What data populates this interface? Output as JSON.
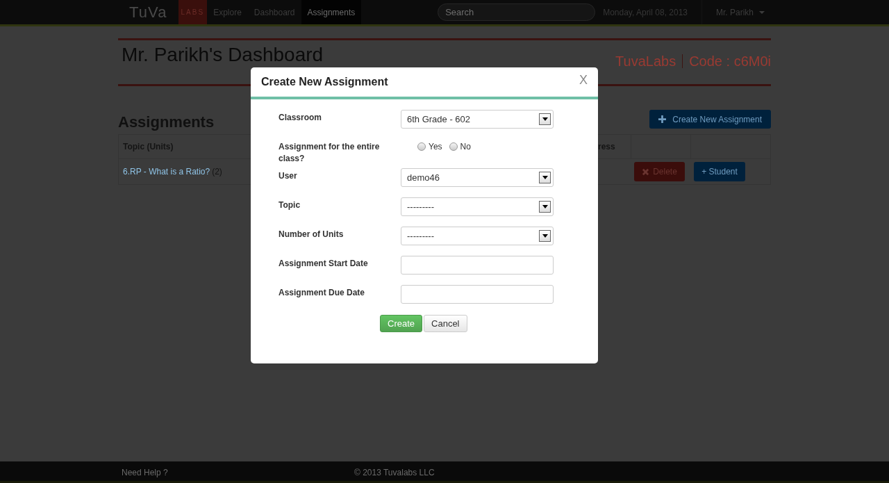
{
  "navbar": {
    "logo": "TuVa",
    "logo_badge": "LABS",
    "items": [
      {
        "label": "Explore",
        "selected": false
      },
      {
        "label": "Dashboard",
        "selected": false
      },
      {
        "label": "Assignments",
        "selected": true
      }
    ],
    "search": {
      "placeholder": "Search"
    },
    "date": "Monday, April 08, 2013",
    "user": "Mr. Parikh"
  },
  "page": {
    "title": "Mr. Parikh's Dashboard",
    "brand": "TuvaLabs",
    "code_label": "Code : c6M0i"
  },
  "assignments": {
    "heading": "Assignments",
    "create_button": "Create New Assignment",
    "columns": [
      "Topic (Units)",
      "ress"
    ],
    "rows": [
      {
        "topic": "6.RP - What is a Ratio?",
        "units": "(2)",
        "delete": "Delete",
        "student": "+ Student"
      }
    ]
  },
  "modal": {
    "title": "Create New Assignment",
    "close": "X",
    "fields": [
      {
        "kind": "select",
        "label": "Classroom",
        "value": "6th Grade - 602"
      },
      {
        "kind": "radio",
        "label": "Assignment for the entire class?",
        "options": [
          {
            "label": "Yes",
            "selected": false
          },
          {
            "label": "No",
            "selected": false
          }
        ]
      },
      {
        "kind": "select",
        "label": "User",
        "value": "demo46"
      },
      {
        "kind": "select",
        "label": "Topic",
        "value": "---------"
      },
      {
        "kind": "select",
        "label": "Number of Units",
        "value": "---------"
      },
      {
        "kind": "text",
        "label": "Assignment Start Date"
      },
      {
        "kind": "text",
        "label": "Assignment Due Date"
      }
    ],
    "buttons": [
      {
        "label": "Create",
        "kind": "primary"
      },
      {
        "label": "Cancel",
        "kind": "default"
      }
    ]
  },
  "footer": {
    "help": "Need Help ?",
    "copyright": "© 2013 Tuvalabs LLC"
  }
}
